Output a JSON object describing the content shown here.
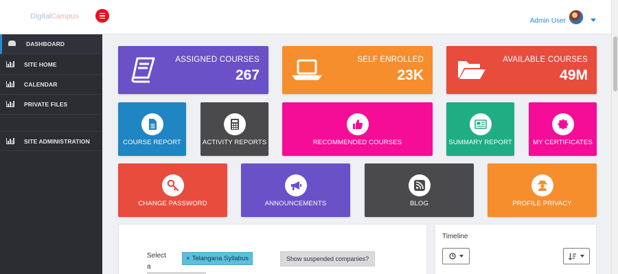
{
  "header": {
    "logo_text_a": "Digital",
    "logo_text_b": "Campus",
    "user_name": "Admin User"
  },
  "sidebar": {
    "items": [
      {
        "label": "DASHBOARD",
        "icon": "dashboard-icon"
      },
      {
        "label": "SITE HOME",
        "icon": "bar-chart-icon"
      },
      {
        "label": "CALENDAR",
        "icon": "bar-chart-icon"
      },
      {
        "label": "PRIVATE FILES",
        "icon": "bar-chart-icon"
      },
      {
        "label": "SITE ADMINISTRATION",
        "icon": "bar-chart-icon"
      }
    ]
  },
  "stats": [
    {
      "title": "ASSIGNED COURSES",
      "value": "267",
      "color": "#6a51c7",
      "icon": "book-icon"
    },
    {
      "title": "SELF ENROLLED",
      "value": "23K",
      "color": "#f68e2e",
      "icon": "laptop-icon"
    },
    {
      "title": "AVAILABLE COURSES",
      "value": "49M",
      "color": "#e84c3d",
      "icon": "folder-open-icon"
    }
  ],
  "tiles_row1": [
    {
      "label": "COURSE REPORT",
      "color": "#1f85c3",
      "icon": "file-text-icon"
    },
    {
      "label": "ACTIVITY REPORTS",
      "color": "#4a4a4d",
      "icon": "calculator-icon"
    },
    {
      "label": "RECOMMENDED COURSES",
      "color": "#f50d97",
      "icon": "thumbs-up-icon"
    },
    {
      "label": "SUMMARY REPORT",
      "color": "#1fad84",
      "icon": "newspaper-icon"
    },
    {
      "label": "MY CERTIFICATES",
      "color": "#f50d97",
      "icon": "certificate-icon"
    }
  ],
  "tiles_row2": [
    {
      "label": "CHANGE PASSWORD",
      "color": "#e84c3d",
      "icon": "key-icon"
    },
    {
      "label": "ANNOUNCEMENTS",
      "color": "#6a51c7",
      "icon": "bullhorn-icon"
    },
    {
      "label": "BLOG",
      "color": "#4a4a4d",
      "icon": "rss-icon"
    },
    {
      "label": "PROFILE PRIVACY",
      "color": "#f68e2e",
      "icon": "user-secret-icon"
    }
  ],
  "filter": {
    "select_label": "Select a",
    "chip_remove": "×",
    "chip_label": "Telangana Syllabus",
    "suspended_button": "Show suspended companies?"
  },
  "timeline": {
    "title": "Timeline"
  }
}
